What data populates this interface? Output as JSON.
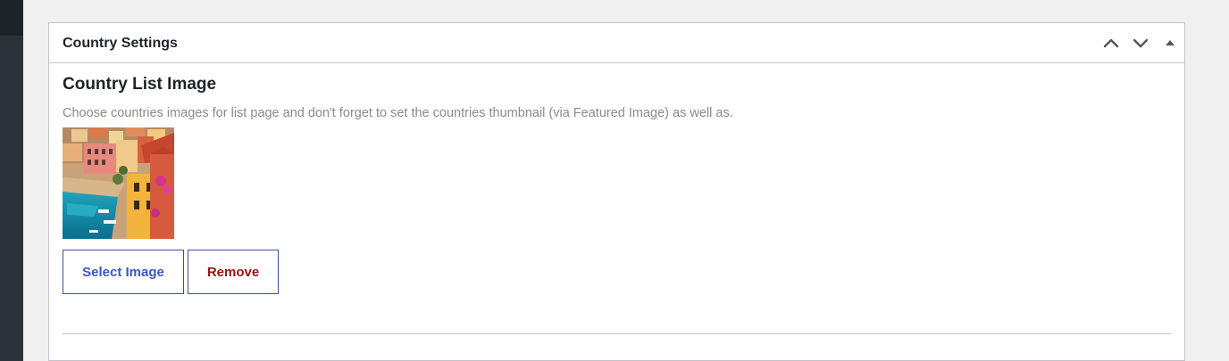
{
  "metabox": {
    "title": "Country Settings"
  },
  "field": {
    "title": "Country List Image",
    "description": "Choose countries images for list page and don't forget to set the countries thumbnail (via Featured Image) as well as."
  },
  "buttons": {
    "select_label": "Select Image",
    "remove_label": "Remove"
  },
  "handles": {
    "up_icon": "chevron-up-icon",
    "down_icon": "chevron-down-icon",
    "toggle_icon": "triangle-up-icon"
  },
  "colors": {
    "link_blue": "#3858c0",
    "remove_red": "#9a1111",
    "button_border": "#3a4ea8",
    "description_gray": "#8a8a8a"
  }
}
